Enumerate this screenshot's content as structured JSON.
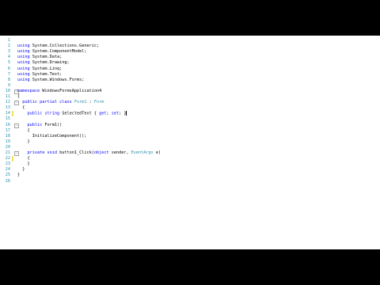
{
  "editor": {
    "colors": {
      "keyword": "#0000ff",
      "type": "#2b91af",
      "line_number": "#2b91af",
      "changed_marker": "#f0e060",
      "saved_marker": "#58b058",
      "background": "#ffffff"
    },
    "lines": [
      {
        "n": "1",
        "marker": "none",
        "indent": 0,
        "segs": []
      },
      {
        "n": "2",
        "marker": "none",
        "indent": 0,
        "segs": [
          {
            "t": "using",
            "c": "kw"
          },
          {
            "t": " System.Collections.Generic;",
            "c": "ident"
          }
        ]
      },
      {
        "n": "3",
        "marker": "none",
        "indent": 0,
        "segs": [
          {
            "t": "using",
            "c": "kw"
          },
          {
            "t": " System.ComponentModel;",
            "c": "ident"
          }
        ]
      },
      {
        "n": "4",
        "marker": "none",
        "indent": 0,
        "segs": [
          {
            "t": "using",
            "c": "kw"
          },
          {
            "t": " System.Data;",
            "c": "ident"
          }
        ]
      },
      {
        "n": "5",
        "marker": "none",
        "indent": 0,
        "segs": [
          {
            "t": "using",
            "c": "kw"
          },
          {
            "t": " System.Drawing;",
            "c": "ident"
          }
        ]
      },
      {
        "n": "6",
        "marker": "none",
        "indent": 0,
        "segs": [
          {
            "t": "using",
            "c": "kw"
          },
          {
            "t": " System.Linq;",
            "c": "ident"
          }
        ]
      },
      {
        "n": "7",
        "marker": "none",
        "indent": 0,
        "segs": [
          {
            "t": "using",
            "c": "kw"
          },
          {
            "t": " System.Text;",
            "c": "ident"
          }
        ]
      },
      {
        "n": "8",
        "marker": "none",
        "indent": 0,
        "segs": [
          {
            "t": "using",
            "c": "kw"
          },
          {
            "t": " System.Windows.Forms;",
            "c": "ident"
          }
        ]
      },
      {
        "n": "9",
        "marker": "none",
        "indent": 0,
        "segs": []
      },
      {
        "n": "10",
        "marker": "none",
        "indent": 0,
        "fold": "−",
        "segs": [
          {
            "t": "namespace",
            "c": "kw"
          },
          {
            "t": " WindowsFormsApplication4",
            "c": "ident"
          }
        ]
      },
      {
        "n": "11",
        "marker": "none",
        "indent": 0,
        "segs": [
          {
            "t": "{",
            "c": "ident"
          }
        ]
      },
      {
        "n": "12",
        "marker": "none",
        "indent": 2,
        "fold": "−",
        "segs": [
          {
            "t": "public",
            "c": "kw"
          },
          {
            "t": " ",
            "c": "ident"
          },
          {
            "t": "partial",
            "c": "kw"
          },
          {
            "t": " ",
            "c": "ident"
          },
          {
            "t": "class",
            "c": "kw"
          },
          {
            "t": " ",
            "c": "ident"
          },
          {
            "t": "Form1",
            "c": "ty"
          },
          {
            "t": " : ",
            "c": "ident"
          },
          {
            "t": "Form",
            "c": "ty"
          }
        ]
      },
      {
        "n": "13",
        "marker": "none",
        "indent": 2,
        "segs": [
          {
            "t": "{",
            "c": "ident"
          }
        ]
      },
      {
        "n": "14",
        "marker": "changed",
        "indent": 4,
        "segs": [
          {
            "t": "public",
            "c": "kw"
          },
          {
            "t": " ",
            "c": "ident"
          },
          {
            "t": "string",
            "c": "kw"
          },
          {
            "t": " SelectedText { ",
            "c": "ident"
          },
          {
            "t": "get",
            "c": "kw"
          },
          {
            "t": "; ",
            "c": "ident"
          },
          {
            "t": "set",
            "c": "kw"
          },
          {
            "t": "; }",
            "c": "ident"
          }
        ],
        "caret": true
      },
      {
        "n": "15",
        "marker": "none",
        "indent": 0,
        "segs": []
      },
      {
        "n": "16",
        "marker": "none",
        "indent": 4,
        "fold": "−",
        "segs": [
          {
            "t": "public",
            "c": "kw"
          },
          {
            "t": " Form1()",
            "c": "ident"
          }
        ]
      },
      {
        "n": "17",
        "marker": "none",
        "indent": 4,
        "segs": [
          {
            "t": "{",
            "c": "ident"
          }
        ]
      },
      {
        "n": "18",
        "marker": "none",
        "indent": 6,
        "segs": [
          {
            "t": "InitializeComponent();",
            "c": "ident"
          }
        ]
      },
      {
        "n": "19",
        "marker": "none",
        "indent": 4,
        "segs": [
          {
            "t": "}",
            "c": "ident"
          }
        ]
      },
      {
        "n": "20",
        "marker": "none",
        "indent": 0,
        "segs": []
      },
      {
        "n": "21",
        "marker": "none",
        "indent": 4,
        "fold": "−",
        "segs": [
          {
            "t": "private",
            "c": "kw"
          },
          {
            "t": " ",
            "c": "ident"
          },
          {
            "t": "void",
            "c": "kw"
          },
          {
            "t": " button1_Click(",
            "c": "ident"
          },
          {
            "t": "object",
            "c": "kw"
          },
          {
            "t": " sender, ",
            "c": "ident"
          },
          {
            "t": "EventArgs",
            "c": "ty"
          },
          {
            "t": " e)",
            "c": "ident"
          }
        ]
      },
      {
        "n": "22",
        "marker": "changed",
        "indent": 4,
        "segs": [
          {
            "t": "{",
            "c": "ident"
          }
        ]
      },
      {
        "n": "23",
        "marker": "none",
        "indent": 4,
        "segs": [
          {
            "t": "}",
            "c": "ident"
          }
        ]
      },
      {
        "n": "24",
        "marker": "none",
        "indent": 2,
        "segs": [
          {
            "t": "}",
            "c": "ident"
          }
        ]
      },
      {
        "n": "25",
        "marker": "none",
        "indent": 0,
        "segs": [
          {
            "t": "}",
            "c": "ident"
          }
        ]
      },
      {
        "n": "26",
        "marker": "none",
        "indent": 0,
        "segs": []
      }
    ]
  }
}
